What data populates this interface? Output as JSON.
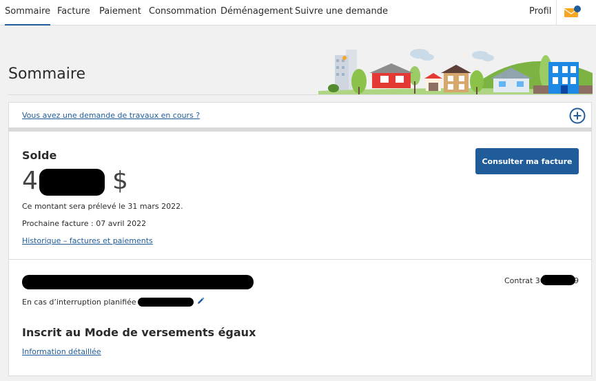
{
  "nav": {
    "items": [
      {
        "label": "Sommaire",
        "active": true
      },
      {
        "label": "Facture"
      },
      {
        "label": "Paiement"
      },
      {
        "label": "Consommation"
      },
      {
        "label": "Déménagement"
      },
      {
        "label": "Suivre une demande"
      }
    ],
    "profil_label": "Profil",
    "mail_icon": "envelope-notification-icon"
  },
  "header": {
    "title": "Sommaire",
    "illustration": "neighborhood-houses-illustration"
  },
  "work_request": {
    "link_text": "Vous avez une demande de travaux en cours ?",
    "expand_icon": "plus-circle-icon"
  },
  "balance": {
    "label": "Solde",
    "amount_prefix": "4",
    "currency": "$",
    "withdrawal_note": "Ce montant sera prélevé le 31 mars 2022.",
    "next_bill": "Prochaine facture : 07 avril 2022",
    "history_link": "Historique – factures et paiements",
    "consult_button": "Consulter ma facture"
  },
  "account": {
    "contract_prefix": "Contrat 30",
    "contract_suffix": "9",
    "interruption_label": "En cas d’interruption planifiée :",
    "edit_icon": "pencil-icon"
  },
  "equal_payments": {
    "title": "Inscrit au Mode de versements égaux",
    "link_text": "Information détaillée"
  },
  "colors": {
    "accent": "#1f5c99",
    "page_bg": "#f1f1f1",
    "card_bg": "#ffffff"
  }
}
